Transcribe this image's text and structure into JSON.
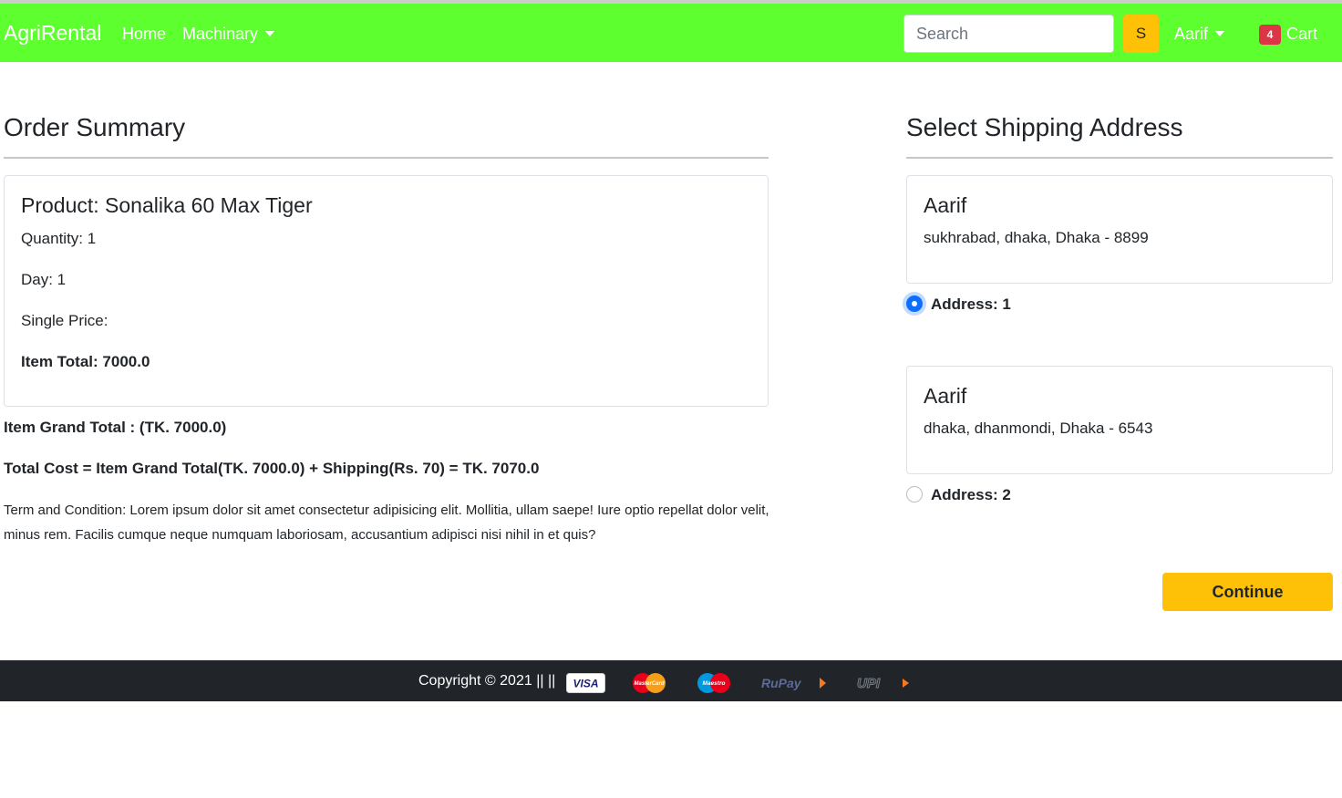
{
  "navbar": {
    "brand": "AgriRental",
    "home": "Home",
    "machinary": "Machinary",
    "search_placeholder": "Search",
    "search_button": "S",
    "user": "Aarif",
    "cart_count": "4",
    "cart": "Cart",
    "colors": {
      "navbar_bg": "#5dff2f",
      "accent": "#ffc107",
      "badge": "#dc3545"
    }
  },
  "order_summary": {
    "title": "Order Summary",
    "product": {
      "title": "Product: Sonalika 60 Max Tiger",
      "quantity": "Quantity: 1",
      "day": "Day: 1",
      "single_price": "Single Price:",
      "item_total": "Item Total: 7000.0"
    },
    "grand_total": "Item Grand Total : (TK. 7000.0)",
    "total_cost": "Total Cost = Item Grand Total(TK. 7000.0) + Shipping(Rs. 70) = TK. 7070.0",
    "terms": "Term and Condition: Lorem ipsum dolor sit amet consectetur adipisicing elit. Mollitia, ullam saepe! Iure optio repellat dolor velit, minus rem. Facilis cumque neque numquam laboriosam, accusantium adipisci nisi nihil in et quis?"
  },
  "shipping": {
    "title": "Select Shipping Address",
    "addresses": [
      {
        "name": "Aarif",
        "line": "sukhrabad, dhaka, Dhaka - 8899",
        "label": "Address: 1",
        "selected": true
      },
      {
        "name": "Aarif",
        "line": "dhaka, dhanmondi, Dhaka - 6543",
        "label": "Address: 2",
        "selected": false
      }
    ],
    "continue": "Continue"
  },
  "footer": {
    "copyright": "Copyright © 2021 || ||",
    "payment_icons": [
      "visa-icon",
      "mastercard-icon",
      "maestro-icon",
      "rupay-icon",
      "upi-icon"
    ],
    "visa_text": "VISA",
    "mastercard_text": "MasterCard",
    "maestro_text": "Maestro",
    "rupay_text": "RuPay",
    "upi_text": "UPI"
  }
}
